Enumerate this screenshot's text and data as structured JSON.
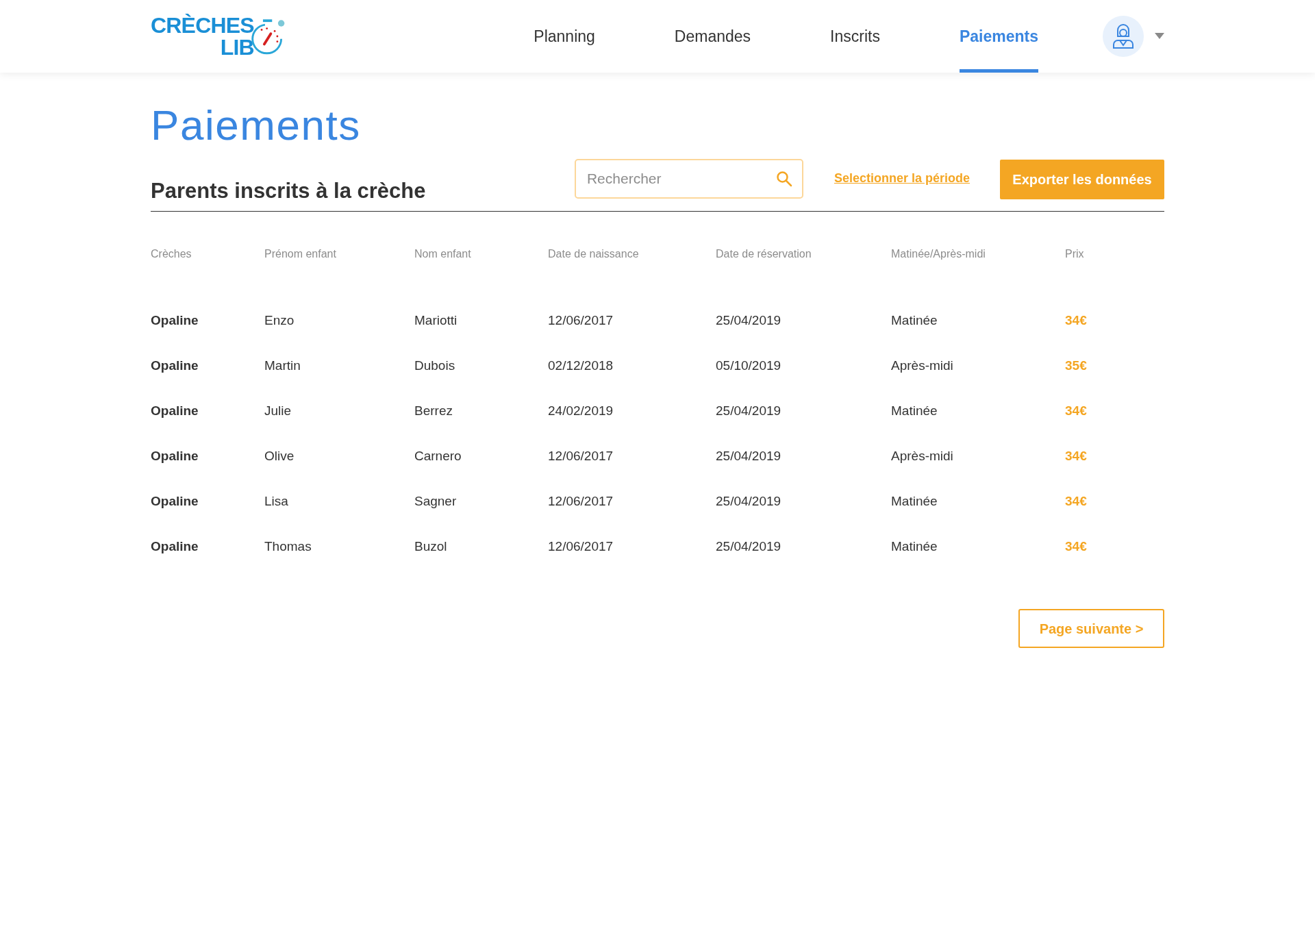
{
  "logo": {
    "line_1": "CRÈCHES",
    "line_2": "LIB"
  },
  "nav": [
    {
      "label": "Planning",
      "selected": false
    },
    {
      "label": "Demandes",
      "selected": false
    },
    {
      "label": "Inscrits",
      "selected": false
    },
    {
      "label": "Paiements",
      "selected": true
    }
  ],
  "page_title": "Paiements",
  "section_title": "Parents inscrits à la crèche",
  "search": {
    "placeholder": "Rechercher"
  },
  "period_link": "Selectionner la période",
  "export_button": "Exporter les données",
  "table": {
    "columns": [
      "Crèches",
      "Prénom enfant",
      "Nom enfant",
      "Date de naissance",
      "Date de réservation",
      "Matinée/Après-midi",
      "Prix"
    ],
    "rows": [
      [
        "Opaline",
        "Enzo",
        "Mariotti",
        "12/06/2017",
        "25/04/2019",
        "Matinée",
        "34€"
      ],
      [
        "Opaline",
        "Martin",
        "Dubois",
        "02/12/2018",
        "05/10/2019",
        "Après-midi",
        "35€"
      ],
      [
        "Opaline",
        "Julie",
        "Berrez",
        "24/02/2019",
        "25/04/2019",
        "Matinée",
        "34€"
      ],
      [
        "Opaline",
        "Olive",
        "Carnero",
        "12/06/2017",
        "25/04/2019",
        "Après-midi",
        "34€"
      ],
      [
        "Opaline",
        "Lisa",
        "Sagner",
        "12/06/2017",
        "25/04/2019",
        "Matinée",
        "34€"
      ],
      [
        "Opaline",
        "Thomas",
        "Buzol",
        "12/06/2017",
        "25/04/2019",
        "Matinée",
        "34€"
      ]
    ]
  },
  "next_page_button": "Page suivante >"
}
